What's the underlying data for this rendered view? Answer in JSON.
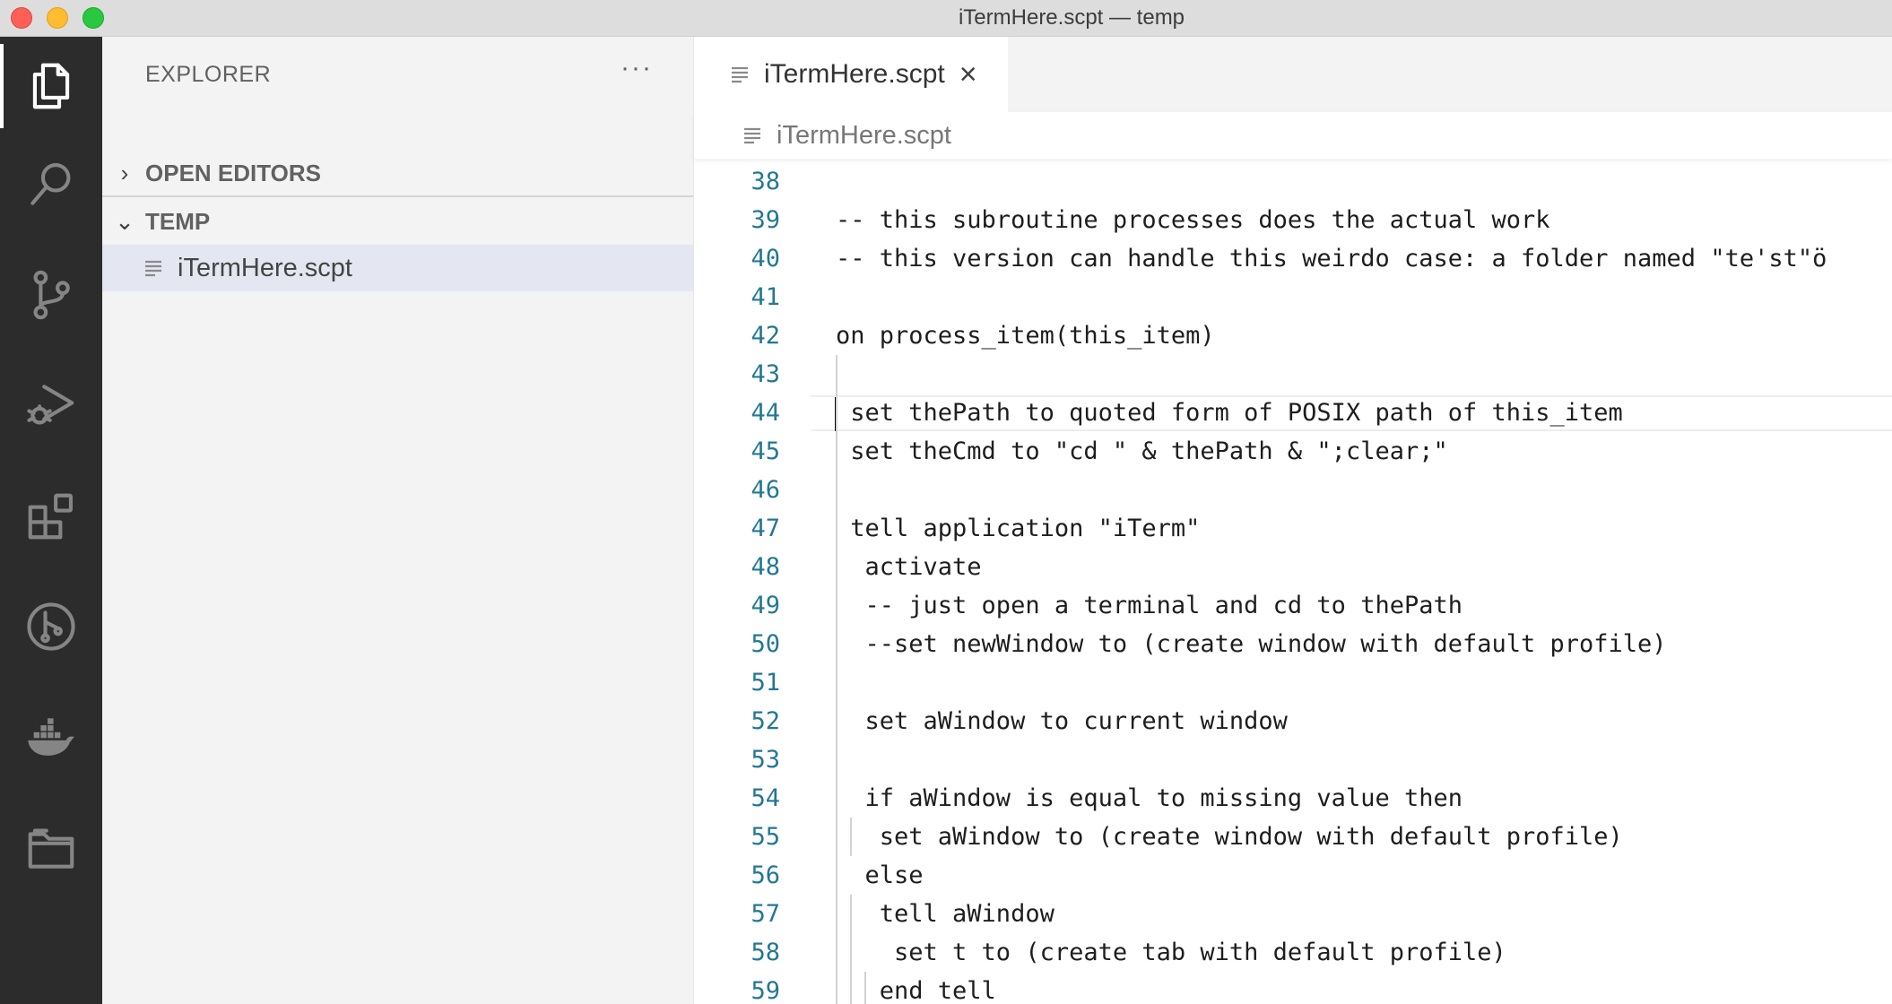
{
  "window": {
    "title": "iTermHere.scpt — temp"
  },
  "activity_bar": {
    "icons": [
      "files-icon",
      "search-icon",
      "source-control-icon",
      "run-debug-icon",
      "extensions-icon",
      "git-graph-icon",
      "docker-icon",
      "folder-icon"
    ],
    "active": "files-icon"
  },
  "sidebar": {
    "header": "EXPLORER",
    "more_label": "···",
    "sections": [
      {
        "label": "OPEN EDITORS",
        "chevron": "›",
        "expanded": false
      },
      {
        "label": "TEMP",
        "chevron": "⌄",
        "expanded": true
      }
    ],
    "files": [
      {
        "name": "iTermHere.scpt",
        "selected": true
      }
    ]
  },
  "editor": {
    "tab": {
      "name": "iTermHere.scpt",
      "close": "×"
    },
    "breadcrumb": "iTermHere.scpt",
    "lines": [
      {
        "n": "38",
        "t": ""
      },
      {
        "n": "39",
        "t": "-- this subroutine processes does the actual work"
      },
      {
        "n": "40",
        "t": "-- this version can handle this weirdo case: a folder named \"te'st\"ö"
      },
      {
        "n": "41",
        "t": ""
      },
      {
        "n": "42",
        "t": "on process_item(this_item)"
      },
      {
        "n": "43",
        "t": ""
      },
      {
        "n": "44",
        "t": " set thePath to quoted form of POSIX path of this_item"
      },
      {
        "n": "45",
        "t": " set theCmd to \"cd \" & thePath & \";clear;\""
      },
      {
        "n": "46",
        "t": ""
      },
      {
        "n": "47",
        "t": " tell application \"iTerm\""
      },
      {
        "n": "48",
        "t": "  activate"
      },
      {
        "n": "49",
        "t": "  -- just open a terminal and cd to thePath"
      },
      {
        "n": "50",
        "t": "  --set newWindow to (create window with default profile)"
      },
      {
        "n": "51",
        "t": ""
      },
      {
        "n": "52",
        "t": "  set aWindow to current window"
      },
      {
        "n": "53",
        "t": ""
      },
      {
        "n": "54",
        "t": "  if aWindow is equal to missing value then"
      },
      {
        "n": "55",
        "t": "   set aWindow to (create window with default profile)"
      },
      {
        "n": "56",
        "t": "  else"
      },
      {
        "n": "57",
        "t": "   tell aWindow"
      },
      {
        "n": "58",
        "t": "    set t to (create tab with default profile)"
      },
      {
        "n": "59",
        "t": "   end tell"
      }
    ]
  }
}
